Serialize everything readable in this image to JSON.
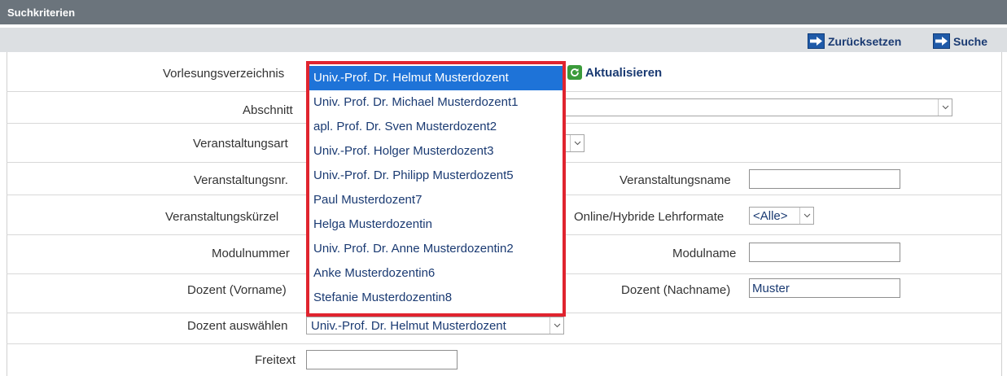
{
  "header": {
    "title": "Suchkriterien"
  },
  "toolbar": {
    "reset_label": "Zurücksetzen",
    "search_label": "Suche"
  },
  "fields": {
    "vorlesungsverzeichnis": {
      "label": "Vorlesungsverzeichnis",
      "refresh_label": "Aktualisieren"
    },
    "abschnitt": {
      "label": "Abschnitt",
      "value": ""
    },
    "veranstaltungsart": {
      "label": "Veranstaltungsart",
      "value": ""
    },
    "veranstaltungsnr": {
      "label": "Veranstaltungsnr.",
      "value": ""
    },
    "veranstaltungsname": {
      "label": "Veranstaltungsname",
      "value": ""
    },
    "veranstaltungskuerzel": {
      "label": "Veranstaltungskürzel",
      "value": ""
    },
    "lehrformate": {
      "label": "Online/Hybride Lehrformate",
      "value": "<Alle>"
    },
    "modulnummer": {
      "label": "Modulnummer",
      "value": ""
    },
    "modulname": {
      "label": "Modulname",
      "value": ""
    },
    "dozent_vorname": {
      "label": "Dozent (Vorname)",
      "value": ""
    },
    "dozent_nachname": {
      "label": "Dozent (Nachname)",
      "value": "Muster"
    },
    "dozent_auswaehlen": {
      "label": "Dozent auswählen",
      "value": "Univ.-Prof. Dr. Helmut Musterdozent"
    },
    "freitext": {
      "label": "Freitext",
      "value": ""
    }
  },
  "dropdown": {
    "options": [
      "Univ.-Prof. Dr. Helmut Musterdozent",
      "Univ. Prof. Dr. Michael Musterdozent1",
      "apl. Prof. Dr. Sven Musterdozent2",
      "Univ.-Prof. Holger Musterdozent3",
      "Univ.-Prof. Dr. Philipp Musterdozent5",
      "Paul Musterdozent7",
      "Helga Musterdozentin",
      "Univ. Prof. Dr. Anne Musterdozentin2",
      "Anke Musterdozentin6",
      "Stefanie Musterdozentin8"
    ],
    "selected_index": 0
  },
  "colors": {
    "header_bg": "#6b747c",
    "toolbar_bg": "#dcdfe2",
    "highlight": "#e0242f",
    "selected_option": "#1e73d8",
    "text_link": "#1a3a72"
  }
}
